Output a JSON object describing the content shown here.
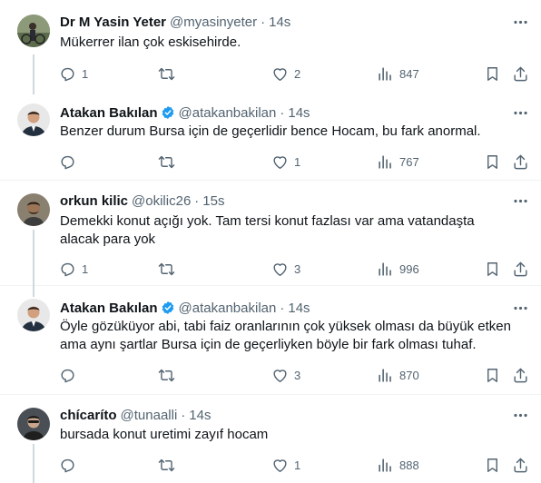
{
  "tweets": [
    {
      "name": "Dr M Yasin Yeter",
      "handle": "@myasinyeter",
      "time": "14s",
      "verified": false,
      "text": "Mükerrer ilan çok eskisehirde.",
      "replies": "1",
      "retweets": "",
      "likes": "2",
      "views": "847",
      "avatar_color": "#7a8a6a"
    },
    {
      "name": "Atakan Bakılan",
      "handle": "@atakanbakilan",
      "time": "14s",
      "verified": true,
      "text": "Benzer durum Bursa için de geçerlidir bence Hocam, bu fark anormal.",
      "replies": "",
      "retweets": "",
      "likes": "1",
      "views": "767",
      "avatar_color": "#2c3e50"
    },
    {
      "name": "orkun kilic",
      "handle": "@okilic26",
      "time": "15s",
      "verified": false,
      "text": "Demekki konut açığı yok. Tam tersi konut fazlası var ama vatandaşta alacak para yok",
      "replies": "1",
      "retweets": "",
      "likes": "3",
      "views": "996",
      "avatar_color": "#6b5a4a"
    },
    {
      "name": "Atakan Bakılan",
      "handle": "@atakanbakilan",
      "time": "14s",
      "verified": true,
      "text": "Öyle gözüküyor abi, tabi faiz oranlarının çok yüksek olması da büyük etken ama aynı şartlar Bursa için de geçerliyken böyle bir fark olması tuhaf.",
      "replies": "",
      "retweets": "",
      "likes": "3",
      "views": "870",
      "avatar_color": "#2c3e50"
    },
    {
      "name": "chícaríto",
      "handle": "@tunaalli",
      "time": "14s",
      "verified": false,
      "text": "bursada konut uretimi zayıf hocam",
      "replies": "",
      "retweets": "",
      "likes": "1",
      "views": "888",
      "avatar_color": "#3a3a3a"
    }
  ],
  "colors": {
    "text": "#0f1419",
    "muted": "#536471",
    "verified": "#1d9bf0",
    "separator": "#eff3f4",
    "thread_line": "#cfd9de"
  },
  "icons": {
    "reply": "reply-icon",
    "retweet": "retweet-icon",
    "like": "heart-icon",
    "views": "views-icon",
    "bookmark": "bookmark-icon",
    "share": "share-icon",
    "more": "more-icon",
    "verified": "verified-badge-icon"
  }
}
